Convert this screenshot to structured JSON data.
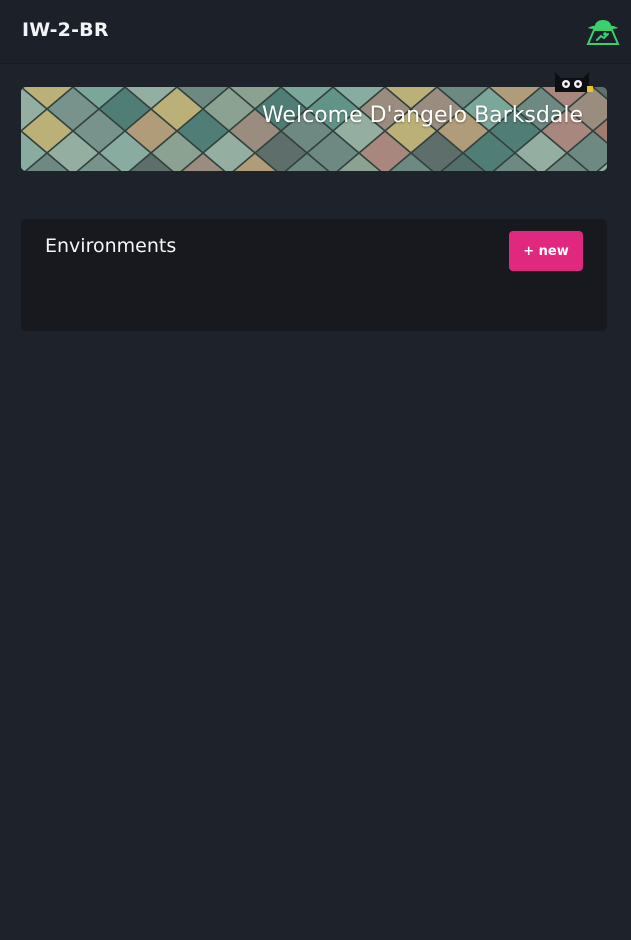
{
  "header": {
    "title": "IW-2-BR",
    "logo_icon": "ufo-icon",
    "logo_color": "#3ccf6e"
  },
  "banner": {
    "welcome_text": "Welcome D'angelo Barksdale",
    "mascot_icon": "cat-icon"
  },
  "environments": {
    "title": "Environments",
    "new_button_label": "+ new",
    "button_color": "#e0287f"
  }
}
